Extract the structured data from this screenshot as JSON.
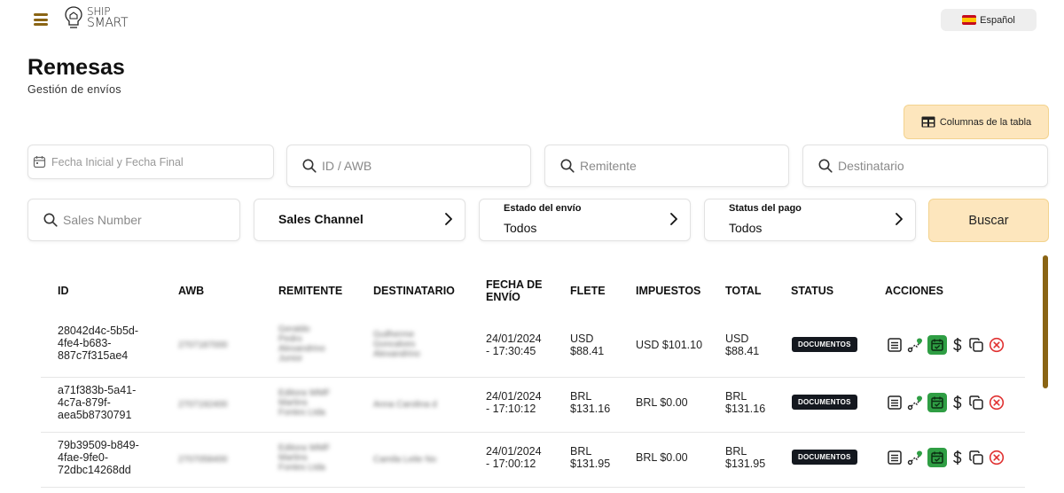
{
  "header": {
    "logo_line1": "SHIP",
    "logo_line2": "SMART",
    "language": "Español"
  },
  "page": {
    "title": "Remesas",
    "subtitle": "Gestión de envíos"
  },
  "toolbar": {
    "columns_label": "Columnas de la tabla"
  },
  "filters": {
    "date_placeholder": "Fecha Inicial y Fecha Final",
    "id_placeholder": "ID / AWB",
    "sender_placeholder": "Remitente",
    "recipient_placeholder": "Destinatario",
    "sales_number_placeholder": "Sales Number",
    "sales_channel_label": "Sales Channel",
    "shipment_status_label": "Estado del envío",
    "shipment_status_value": "Todos",
    "payment_status_label": "Status del pago",
    "payment_status_value": "Todos",
    "search_button": "Buscar"
  },
  "table": {
    "columns": {
      "id": "ID",
      "awb": "AWB",
      "sender": "REMITENTE",
      "recipient": "DESTINATARIO",
      "date_line1": "FECHA DE",
      "date_line2": "ENVÍO",
      "freight": "FLETE",
      "taxes": "IMPUESTOS",
      "total": "TOTAL",
      "status": "STATUS",
      "actions": "ACCIONES"
    },
    "rows": [
      {
        "id": [
          "28042d4c-5b5d-",
          "4fe4-b683-",
          "887c7f315ae4"
        ],
        "awb": "2707187000",
        "sender": [
          "Geraldo",
          "Pedro",
          "Alexandrino",
          "Junior"
        ],
        "recipient": [
          "Guilherme",
          "Goncalves",
          "Alexandrino"
        ],
        "date": [
          "24/01/2024",
          "- 17:30:45"
        ],
        "freight": [
          "USD",
          "$88.41"
        ],
        "taxes": "USD $101.10",
        "total": [
          "USD",
          "$88.41"
        ],
        "status": "DOCUMENTOS"
      },
      {
        "id": [
          "a71f383b-5a41-",
          "4c7a-879f-",
          "aea5b8730791"
        ],
        "awb": "2707192400",
        "sender": [
          "Editora WMF",
          "Martins",
          "Fontes Ltda"
        ],
        "recipient": [
          "Anna Carolina d"
        ],
        "date": [
          "24/01/2024",
          "- 17:10:12"
        ],
        "freight": [
          "BRL",
          "$131.16"
        ],
        "taxes": "BRL $0.00",
        "total": [
          "BRL",
          "$131.16"
        ],
        "status": "DOCUMENTOS"
      },
      {
        "id": [
          "79b39509-b849-",
          "4fae-9fe0-",
          "72dbc14268dd"
        ],
        "awb": "2707058400",
        "sender": [
          "Editora WMF",
          "Martins",
          "Fontes Ltda"
        ],
        "recipient": [
          "Camila Leite No"
        ],
        "date": [
          "24/01/2024",
          "- 17:00:12"
        ],
        "freight": [
          "BRL",
          "$131.95"
        ],
        "taxes": "BRL $0.00",
        "total": [
          "BRL",
          "$131.95"
        ],
        "status": "DOCUMENTOS"
      }
    ]
  },
  "colors": {
    "accent_brown": "#8a6414",
    "button_peach": "#fde6bd",
    "badge_dark": "#14181f",
    "action_green": "#2f9e44",
    "cancel_red": "#e03131"
  },
  "icons": [
    "menu-icon",
    "ship-smart-logo",
    "spain-flag-icon",
    "table-columns-icon",
    "calendar-icon",
    "search-icon",
    "chevron-right-icon",
    "document-icon",
    "route-icon",
    "calendar-check-icon",
    "dollar-icon",
    "copy-icon",
    "cancel-icon"
  ]
}
